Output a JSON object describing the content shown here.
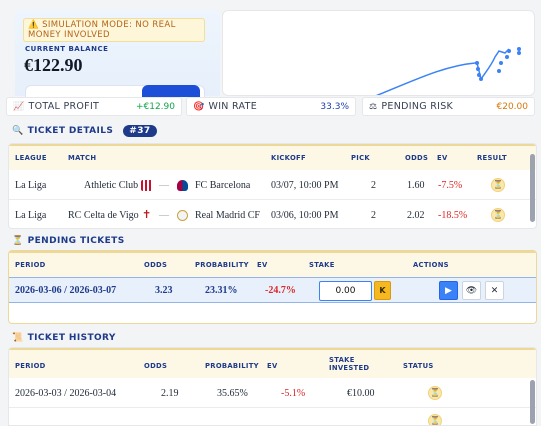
{
  "balance": {
    "simulation_notice": "⚠️ SIMULATION MODE: NO REAL MONEY INVOLVED",
    "label": "CURRENT BALANCE",
    "value": "€122.90"
  },
  "stats": [
    {
      "icon": "chart-up-icon",
      "glyph": "📈",
      "label": "TOTAL PROFIT",
      "value": "+€12.90",
      "color": "#16a34a"
    },
    {
      "icon": "target-icon",
      "glyph": "🎯",
      "label": "WIN RATE",
      "value": "33.3%",
      "color": "#1e40af"
    },
    {
      "icon": "scales-icon",
      "glyph": "⚖",
      "label": "PENDING RISK",
      "value": "€20.00",
      "color": "#d97706"
    }
  ],
  "ticket_details": {
    "title": "TICKET DETAILS",
    "icon": "magnifier-icon",
    "badge": "#37",
    "headers": {
      "league": "LEAGUE",
      "match": "MATCH",
      "kickoff": "KICKOFF",
      "pick": "PICK",
      "odds": "ODDS",
      "ev": "EV",
      "result": "RESULT"
    },
    "rows": [
      {
        "league": "La Liga",
        "home": "Athletic Club",
        "away": "FC Barcelona",
        "kickoff": "03/07, 10:00 PM",
        "pick": "2",
        "odds": "1.60",
        "ev": "-7.5%"
      },
      {
        "league": "La Liga",
        "home": "RC Celta de Vigo",
        "away": "Real Madrid CF",
        "kickoff": "03/06, 10:00 PM",
        "pick": "2",
        "odds": "2.02",
        "ev": "-18.5%"
      }
    ]
  },
  "pending": {
    "title": "PENDING TICKETS",
    "headers": {
      "period": "PERIOD",
      "odds": "ODDS",
      "probability": "PROBABILITY",
      "ev": "EV",
      "stake": "STAKE",
      "actions": "ACTIONS"
    },
    "rows": [
      {
        "period": "2026-03-06 / 2026-03-07",
        "odds": "3.23",
        "probability": "23.31%",
        "ev": "-24.7%",
        "stake_placeholder": "0.00",
        "k_label": "K"
      }
    ]
  },
  "history": {
    "title": "TICKET HISTORY",
    "headers": {
      "period": "PERIOD",
      "odds": "ODDS",
      "probability": "PROBABILITY",
      "ev": "EV",
      "stake": "STAKE INVESTED",
      "status": "STATUS"
    },
    "rows": [
      {
        "period": "2026-03-03 / 2026-03-04",
        "odds": "2.19",
        "probability": "35.65%",
        "ev": "-5.1%",
        "stake": "€10.00"
      }
    ]
  },
  "colors": {
    "accent": "#1e3a8a",
    "negative": "#dc2626",
    "positive": "#16a34a",
    "header_bg": "#fdf8e6"
  }
}
